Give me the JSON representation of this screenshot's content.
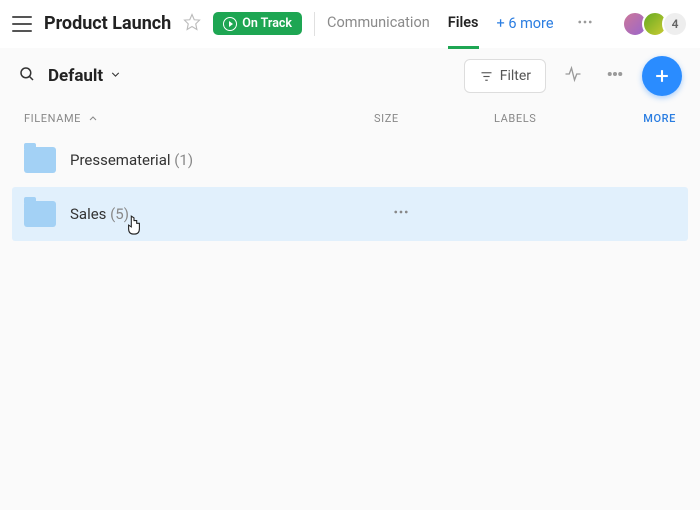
{
  "header": {
    "title": "Product Launch",
    "status_label": "On Track",
    "tabs": {
      "communication": "Communication",
      "files": "Files",
      "more": "+ 6 more"
    },
    "avatar_overflow": "4"
  },
  "toolbar": {
    "view_name": "Default",
    "filter_label": "Filter"
  },
  "columns": {
    "filename": "Filename",
    "size": "Size",
    "labels": "Labels",
    "more": "MORE"
  },
  "rows": [
    {
      "name": "Pressematerial",
      "count": "(1)"
    },
    {
      "name": "Sales",
      "count": "(5)"
    }
  ]
}
